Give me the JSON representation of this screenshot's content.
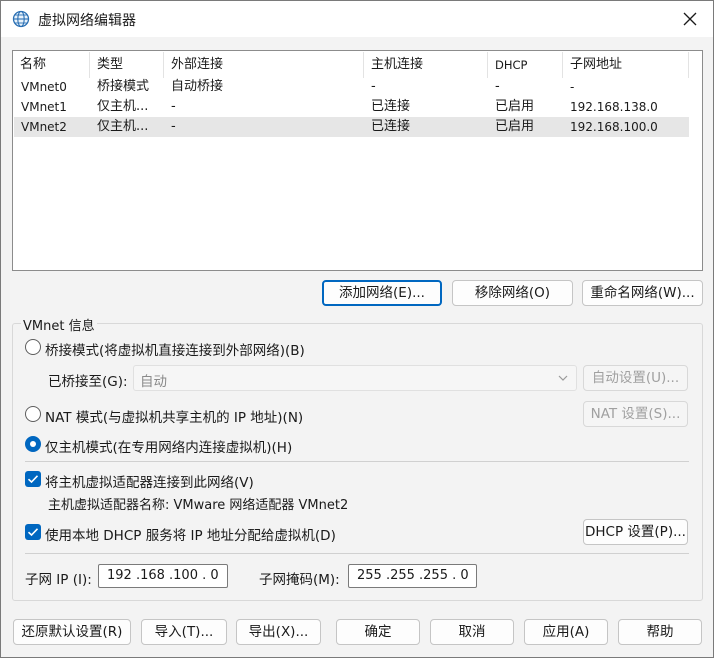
{
  "window": {
    "title": "虚拟网络编辑器"
  },
  "table": {
    "headers": [
      "名称",
      "类型",
      "外部连接",
      "主机连接",
      "DHCP",
      "子网地址"
    ],
    "rows": [
      [
        "VMnet0",
        "桥接模式",
        "自动桥接",
        "-",
        "-",
        "-"
      ],
      [
        "VMnet1",
        "仅主机...",
        "-",
        "已连接",
        "已启用",
        "192.168.138.0"
      ],
      [
        "VMnet2",
        "仅主机...",
        "-",
        "已连接",
        "已启用",
        "192.168.100.0"
      ]
    ],
    "selected_row": 2
  },
  "list_buttons": {
    "add": "添加网络(E)...",
    "remove": "移除网络(O)",
    "rename": "重命名网络(W)..."
  },
  "vmnet_info": {
    "group_label": "VMnet 信息",
    "bridged_label": "桥接模式(将虚拟机直接连接到外部网络)(B)",
    "bridged_to_label": "已桥接至(G):",
    "bridged_to_value": "自动",
    "auto_settings": "自动设置(U)...",
    "nat_label": "NAT 模式(与虚拟机共享主机的 IP 地址)(N)",
    "nat_settings": "NAT 设置(S)...",
    "hostonly_label": "仅主机模式(在专用网络内连接虚拟机)(H)",
    "selected_mode": "hostonly",
    "connect_adapter_label": "将主机虚拟适配器连接到此网络(V)",
    "connect_adapter_checked": true,
    "adapter_name_label": "主机虚拟适配器名称: VMware 网络适配器 VMnet2",
    "dhcp_label": "使用本地 DHCP 服务将 IP 地址分配给虚拟机(D)",
    "dhcp_checked": true,
    "dhcp_settings": "DHCP 设置(P)...",
    "subnet_ip_label": "子网 IP (I):",
    "subnet_ip_value": "192 .168 .100 . 0",
    "subnet_mask_label": "子网掩码(M):",
    "subnet_mask_value": "255 .255 .255 . 0"
  },
  "footer": {
    "restore": "还原默认设置(R)",
    "import": "导入(T)...",
    "export": "导出(X)...",
    "ok": "确定",
    "cancel": "取消",
    "apply": "应用(A)",
    "help": "帮助"
  },
  "colors": {
    "accent": "#0067c0",
    "selected_row": "#e6e6e6",
    "disabled_text": "#8a8a8a"
  }
}
